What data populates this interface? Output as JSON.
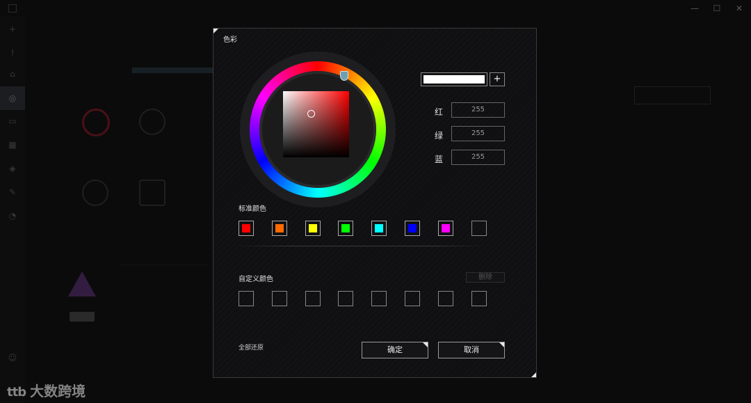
{
  "app": {
    "win_controls": {
      "minimize": "—",
      "maximize": "☐",
      "close": "✕"
    }
  },
  "watermark": {
    "mark": "ttb",
    "text": "大数跨境"
  },
  "dialog": {
    "title": "色彩",
    "preview_color": "#ffffff",
    "add_label": "+",
    "hue_deg": 0,
    "rgb": [
      {
        "label": "红",
        "value": "255"
      },
      {
        "label": "绿",
        "value": "255"
      },
      {
        "label": "蓝",
        "value": "255"
      }
    ],
    "standard_label": "标准颜色",
    "standard_colors": [
      "#ff0000",
      "#ff6a00",
      "#ffff00",
      "#00ff00",
      "#00ffff",
      "#0000ff",
      "#ff00ff",
      ""
    ],
    "custom_label": "自定义颜色",
    "delete_label": "删除",
    "custom_slots": 8,
    "reset_label": "全部还原",
    "ok_label": "确定",
    "cancel_label": "取消"
  }
}
